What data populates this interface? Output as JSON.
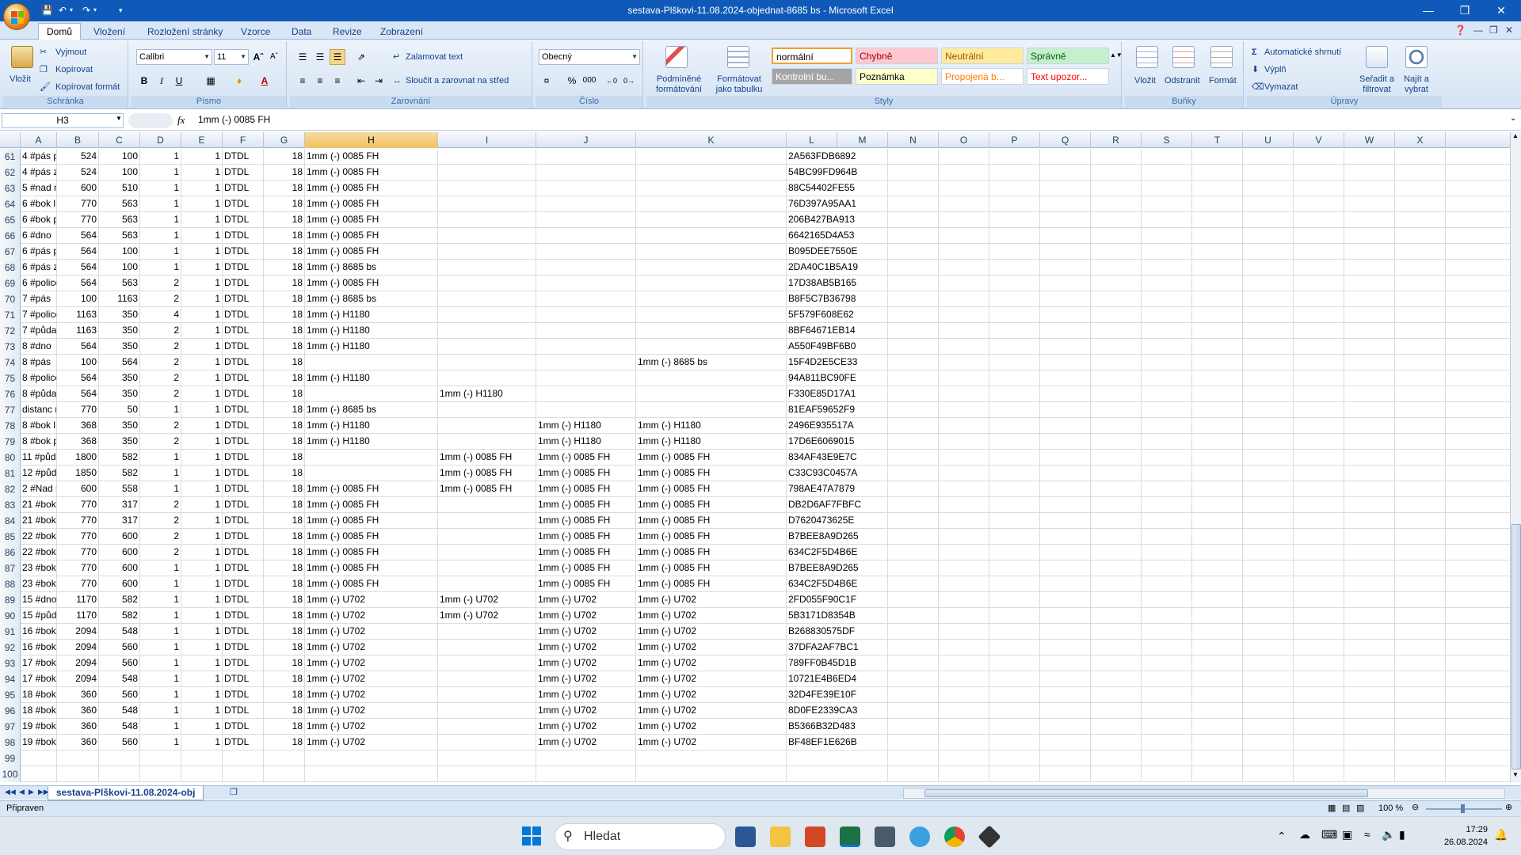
{
  "window": {
    "title": "sestava-Plškovi-11.08.2024-objednat-8685 bs  -  Microsoft Excel",
    "minimize_icon": "minimize-icon",
    "maximize_icon": "restore-icon",
    "close_icon": "close-icon"
  },
  "tabs": [
    "Domů",
    "Vložení",
    "Rozložení stránky",
    "Vzorce",
    "Data",
    "Revize",
    "Zobrazení"
  ],
  "ribbon": {
    "clipboard": {
      "paste": "Vložit",
      "cut": "Vyjmout",
      "copy": "Kopírovat",
      "format_painter": "Kopírovat formát",
      "label": "Schránka"
    },
    "font": {
      "name": "Calibri",
      "size": "11",
      "label": "Písmo",
      "bold": "B",
      "italic": "I",
      "underline": "U"
    },
    "alignment": {
      "wrap": "Zalamovat text",
      "merge": "Sloučit a zarovnat na střed",
      "label": "Zarovnání"
    },
    "number": {
      "format": "Obecný",
      "percent": "%",
      "thousands": "000",
      "label": "Číslo"
    },
    "styles": {
      "conditional": "Podmíněné formátování",
      "as_table": "Formátovat jako tabulku",
      "cells": [
        {
          "text": "normální",
          "bg": "#ffffff",
          "color": "#000000"
        },
        {
          "text": "Chybně",
          "bg": "#ffc7ce",
          "color": "#9c0006"
        },
        {
          "text": "Neutrální",
          "bg": "#ffeb9c",
          "color": "#9c5700"
        },
        {
          "text": "Správně",
          "bg": "#c6efce",
          "color": "#006100"
        },
        {
          "text": "Kontrolní bu...",
          "bg": "#a5a5a5",
          "color": "#ffffff"
        },
        {
          "text": "Poznámka",
          "bg": "#ffffcc",
          "color": "#000000"
        },
        {
          "text": "Propojená b...",
          "bg": "#ffffff",
          "color": "#fa7d00"
        },
        {
          "text": "Text upozor...",
          "bg": "#ffffff",
          "color": "#ff0000"
        }
      ],
      "label": "Styly"
    },
    "cells": {
      "insert": "Vložit",
      "delete": "Odstranit",
      "format": "Formát",
      "label": "Buňky"
    },
    "editing": {
      "autosum": "Automatické shrnutí",
      "fill": "Výplň",
      "clear": "Vymazat",
      "sort": "Seřadit a filtrovat",
      "find": "Najít a vybrat",
      "label": "Úpravy"
    }
  },
  "formula_bar": {
    "cell_ref": "H3",
    "fx": "fx",
    "value": "1mm (-) 0085 FH"
  },
  "columns": [
    "A",
    "B",
    "C",
    "D",
    "E",
    "F",
    "G",
    "H",
    "I",
    "J",
    "K",
    "L",
    "M",
    "N",
    "O",
    "P",
    "Q",
    "R",
    "S",
    "T",
    "U",
    "V",
    "W",
    "X"
  ],
  "selected_column": "H",
  "rows": [
    {
      "n": "61",
      "A": "4 #pás p",
      "B": "524",
      "C": "100",
      "D": "1",
      "E": "1",
      "F": "DTDL",
      "G": "18",
      "H": "1mm (-) 0085 FH",
      "I": "",
      "J": "",
      "K": "",
      "L": "2A563FDB6892"
    },
    {
      "n": "62",
      "A": "4 #pás z",
      "B": "524",
      "C": "100",
      "D": "1",
      "E": "1",
      "F": "DTDL",
      "G": "18",
      "H": "1mm (-) 0085 FH",
      "I": "",
      "J": "",
      "K": "",
      "L": "54BC99FD964B"
    },
    {
      "n": "63",
      "A": "5 #nad mr",
      "B": "600",
      "C": "510",
      "D": "1",
      "E": "1",
      "F": "DTDL",
      "G": "18",
      "H": "1mm (-) 0085 FH",
      "I": "",
      "J": "",
      "K": "",
      "L": "88C54402FE55"
    },
    {
      "n": "64",
      "A": "6 #bok l",
      "B": "770",
      "C": "563",
      "D": "1",
      "E": "1",
      "F": "DTDL",
      "G": "18",
      "H": "1mm (-) 0085 FH",
      "I": "",
      "J": "",
      "K": "",
      "L": "76D397A95AA1"
    },
    {
      "n": "65",
      "A": "6 #bok p",
      "B": "770",
      "C": "563",
      "D": "1",
      "E": "1",
      "F": "DTDL",
      "G": "18",
      "H": "1mm (-) 0085 FH",
      "I": "",
      "J": "",
      "K": "",
      "L": "206B427BA913"
    },
    {
      "n": "66",
      "A": "6 #dno",
      "B": "564",
      "C": "563",
      "D": "1",
      "E": "1",
      "F": "DTDL",
      "G": "18",
      "H": "1mm (-) 0085 FH",
      "I": "",
      "J": "",
      "K": "",
      "L": "6642165D4A53"
    },
    {
      "n": "67",
      "A": "6 #pás p",
      "B": "564",
      "C": "100",
      "D": "1",
      "E": "1",
      "F": "DTDL",
      "G": "18",
      "H": "1mm (-) 0085 FH",
      "I": "",
      "J": "",
      "K": "",
      "L": "B095DEE7550E"
    },
    {
      "n": "68",
      "A": "6 #pás z",
      "B": "564",
      "C": "100",
      "D": "1",
      "E": "1",
      "F": "DTDL",
      "G": "18",
      "H": "1mm (-) 8685 bs",
      "I": "",
      "J": "",
      "K": "",
      "L": "2DA40C1B5A19"
    },
    {
      "n": "69",
      "A": "6 #police",
      "B": "564",
      "C": "563",
      "D": "2",
      "E": "1",
      "F": "DTDL",
      "G": "18",
      "H": "1mm (-) 0085 FH",
      "I": "",
      "J": "",
      "K": "",
      "L": "17D38AB5B165"
    },
    {
      "n": "70",
      "A": "7 #pás",
      "B": "100",
      "C": "1163",
      "D": "2",
      "E": "1",
      "F": "DTDL",
      "G": "18",
      "H": "1mm (-) 8685 bs",
      "I": "",
      "J": "",
      "K": "",
      "L": "B8F5C7B36798"
    },
    {
      "n": "71",
      "A": "7 #police",
      "B": "1163",
      "C": "350",
      "D": "4",
      "E": "1",
      "F": "DTDL",
      "G": "18",
      "H": "1mm (-) H1180",
      "I": "",
      "J": "",
      "K": "",
      "L": "5F579F608E62"
    },
    {
      "n": "72",
      "A": "7 #půda",
      "B": "1163",
      "C": "350",
      "D": "2",
      "E": "1",
      "F": "DTDL",
      "G": "18",
      "H": "1mm (-) H1180",
      "I": "",
      "J": "",
      "K": "",
      "L": "8BF64671EB14"
    },
    {
      "n": "73",
      "A": "8 #dno",
      "B": "564",
      "C": "350",
      "D": "2",
      "E": "1",
      "F": "DTDL",
      "G": "18",
      "H": "1mm (-) H1180",
      "I": "",
      "J": "",
      "K": "",
      "L": "A550F49BF6B0"
    },
    {
      "n": "74",
      "A": "8 #pás",
      "B": "100",
      "C": "564",
      "D": "2",
      "E": "1",
      "F": "DTDL",
      "G": "18",
      "H": "",
      "I": "",
      "J": "",
      "K": "1mm (-) 8685 bs",
      "L": "15F4D2E5CE33"
    },
    {
      "n": "75",
      "A": "8 #police",
      "B": "564",
      "C": "350",
      "D": "2",
      "E": "1",
      "F": "DTDL",
      "G": "18",
      "H": "1mm (-) H1180",
      "I": "",
      "J": "",
      "K": "",
      "L": "94A811BC90FE"
    },
    {
      "n": "76",
      "A": "8 #půda",
      "B": "564",
      "C": "350",
      "D": "2",
      "E": "1",
      "F": "DTDL",
      "G": "18",
      "H": "",
      "I": "1mm (-) H1180",
      "J": "",
      "K": "",
      "L": "F330E85D17A1"
    },
    {
      "n": "77",
      "A": "distanc ro",
      "B": "770",
      "C": "50",
      "D": "1",
      "E": "1",
      "F": "DTDL",
      "G": "18",
      "H": "1mm (-) 8685 bs",
      "I": "",
      "J": "",
      "K": "",
      "L": "81EAF59652F9"
    },
    {
      "n": "78",
      "A": "8 #bok l",
      "B": "368",
      "C": "350",
      "D": "2",
      "E": "1",
      "F": "DTDL",
      "G": "18",
      "H": "1mm (-) H1180",
      "I": "",
      "J": "1mm (-) H1180",
      "K": "1mm (-) H1180",
      "L": "2496E935517A"
    },
    {
      "n": "79",
      "A": "8 #bok p",
      "B": "368",
      "C": "350",
      "D": "2",
      "E": "1",
      "F": "DTDL",
      "G": "18",
      "H": "1mm (-) H1180",
      "I": "",
      "J": "1mm (-) H1180",
      "K": "1mm (-) H1180",
      "L": "17D6E6069015"
    },
    {
      "n": "80",
      "A": "11 #půda",
      "B": "1800",
      "C": "582",
      "D": "1",
      "E": "1",
      "F": "DTDL",
      "G": "18",
      "H": "",
      "I": "1mm (-) 0085 FH",
      "J": "1mm (-) 0085 FH",
      "K": "1mm (-) 0085 FH",
      "L": "834AF43E9E7C"
    },
    {
      "n": "81",
      "A": "12 #půda",
      "B": "1850",
      "C": "582",
      "D": "1",
      "E": "1",
      "F": "DTDL",
      "G": "18",
      "H": "",
      "I": "1mm (-) 0085 FH",
      "J": "1mm (-) 0085 FH",
      "K": "1mm (-) 0085 FH",
      "L": "C33C93C0457A"
    },
    {
      "n": "82",
      "A": "2 #Nad my",
      "B": "600",
      "C": "558",
      "D": "1",
      "E": "1",
      "F": "DTDL",
      "G": "18",
      "H": "1mm (-) 0085 FH",
      "I": "1mm (-) 0085 FH",
      "J": "1mm (-) 0085 FH",
      "K": "1mm (-) 0085 FH",
      "L": "798AE47A7879"
    },
    {
      "n": "83",
      "A": "21 #bok l",
      "B": "770",
      "C": "317",
      "D": "2",
      "E": "1",
      "F": "DTDL",
      "G": "18",
      "H": "1mm (-) 0085 FH",
      "I": "",
      "J": "1mm (-) 0085 FH",
      "K": "1mm (-) 0085 FH",
      "L": "DB2D6AF7FBFC"
    },
    {
      "n": "84",
      "A": "21 #bok p",
      "B": "770",
      "C": "317",
      "D": "2",
      "E": "1",
      "F": "DTDL",
      "G": "18",
      "H": "1mm (-) 0085 FH",
      "I": "",
      "J": "1mm (-) 0085 FH",
      "K": "1mm (-) 0085 FH",
      "L": "D7620473625E"
    },
    {
      "n": "85",
      "A": "22 #bok l",
      "B": "770",
      "C": "600",
      "D": "2",
      "E": "1",
      "F": "DTDL",
      "G": "18",
      "H": "1mm (-) 0085 FH",
      "I": "",
      "J": "1mm (-) 0085 FH",
      "K": "1mm (-) 0085 FH",
      "L": "B7BEE8A9D265"
    },
    {
      "n": "86",
      "A": "22 #bok p",
      "B": "770",
      "C": "600",
      "D": "2",
      "E": "1",
      "F": "DTDL",
      "G": "18",
      "H": "1mm (-) 0085 FH",
      "I": "",
      "J": "1mm (-) 0085 FH",
      "K": "1mm (-) 0085 FH",
      "L": "634C2F5D4B6E"
    },
    {
      "n": "87",
      "A": "23 #bok l",
      "B": "770",
      "C": "600",
      "D": "1",
      "E": "1",
      "F": "DTDL",
      "G": "18",
      "H": "1mm (-) 0085 FH",
      "I": "",
      "J": "1mm (-) 0085 FH",
      "K": "1mm (-) 0085 FH",
      "L": "B7BEE8A9D265"
    },
    {
      "n": "88",
      "A": "23 #bok p",
      "B": "770",
      "C": "600",
      "D": "1",
      "E": "1",
      "F": "DTDL",
      "G": "18",
      "H": "1mm (-) 0085 FH",
      "I": "",
      "J": "1mm (-) 0085 FH",
      "K": "1mm (-) 0085 FH",
      "L": "634C2F5D4B6E"
    },
    {
      "n": "89",
      "A": "15 #dno",
      "B": "1170",
      "C": "582",
      "D": "1",
      "E": "1",
      "F": "DTDL",
      "G": "18",
      "H": "1mm (-) U702",
      "I": "1mm (-) U702",
      "J": "1mm (-) U702",
      "K": "1mm (-) U702",
      "L": "2FD055F90C1F"
    },
    {
      "n": "90",
      "A": "15 #půda",
      "B": "1170",
      "C": "582",
      "D": "1",
      "E": "1",
      "F": "DTDL",
      "G": "18",
      "H": "1mm (-) U702",
      "I": "1mm (-) U702",
      "J": "1mm (-) U702",
      "K": "1mm (-) U702",
      "L": "5B3171D8354B"
    },
    {
      "n": "91",
      "A": "16 #bok l",
      "B": "2094",
      "C": "548",
      "D": "1",
      "E": "1",
      "F": "DTDL",
      "G": "18",
      "H": "1mm (-) U702",
      "I": "",
      "J": "1mm (-) U702",
      "K": "1mm (-) U702",
      "L": "B268830575DF"
    },
    {
      "n": "92",
      "A": "16 #bok p",
      "B": "2094",
      "C": "560",
      "D": "1",
      "E": "1",
      "F": "DTDL",
      "G": "18",
      "H": "1mm (-) U702",
      "I": "",
      "J": "1mm (-) U702",
      "K": "1mm (-) U702",
      "L": "37DFA2AF7BC1"
    },
    {
      "n": "93",
      "A": "17 #bok l",
      "B": "2094",
      "C": "560",
      "D": "1",
      "E": "1",
      "F": "DTDL",
      "G": "18",
      "H": "1mm (-) U702",
      "I": "",
      "J": "1mm (-) U702",
      "K": "1mm (-) U702",
      "L": "789FF0B45D1B"
    },
    {
      "n": "94",
      "A": "17 #bok p",
      "B": "2094",
      "C": "548",
      "D": "1",
      "E": "1",
      "F": "DTDL",
      "G": "18",
      "H": "1mm (-) U702",
      "I": "",
      "J": "1mm (-) U702",
      "K": "1mm (-) U702",
      "L": "10721E4B6ED4"
    },
    {
      "n": "95",
      "A": "18 #bok l",
      "B": "360",
      "C": "560",
      "D": "1",
      "E": "1",
      "F": "DTDL",
      "G": "18",
      "H": "1mm (-) U702",
      "I": "",
      "J": "1mm (-) U702",
      "K": "1mm (-) U702",
      "L": "32D4FE39E10F"
    },
    {
      "n": "96",
      "A": "18 #bok p",
      "B": "360",
      "C": "548",
      "D": "1",
      "E": "1",
      "F": "DTDL",
      "G": "18",
      "H": "1mm (-) U702",
      "I": "",
      "J": "1mm (-) U702",
      "K": "1mm (-) U702",
      "L": "8D0FE2339CA3"
    },
    {
      "n": "97",
      "A": "19 #bok l",
      "B": "360",
      "C": "548",
      "D": "1",
      "E": "1",
      "F": "DTDL",
      "G": "18",
      "H": "1mm (-) U702",
      "I": "",
      "J": "1mm (-) U702",
      "K": "1mm (-) U702",
      "L": "B5366B32D483"
    },
    {
      "n": "98",
      "A": "19 #bok p",
      "B": "360",
      "C": "560",
      "D": "1",
      "E": "1",
      "F": "DTDL",
      "G": "18",
      "H": "1mm (-) U702",
      "I": "",
      "J": "1mm (-) U702",
      "K": "1mm (-) U702",
      "L": "BF48EF1E626B"
    },
    {
      "n": "99"
    },
    {
      "n": "100"
    }
  ],
  "sheet_tab": "sestava-Plškovi-11.08.2024-obj",
  "status": {
    "ready": "Připraven",
    "zoom": "100 %"
  },
  "taskbar": {
    "search_placeholder": "Hledat",
    "time": "17:29",
    "date": "26.08.2024"
  },
  "colors": {
    "titlebar": "#0f5ab8",
    "selected_header": "#f1c15e",
    "ribbon": "#d5e3f3"
  }
}
